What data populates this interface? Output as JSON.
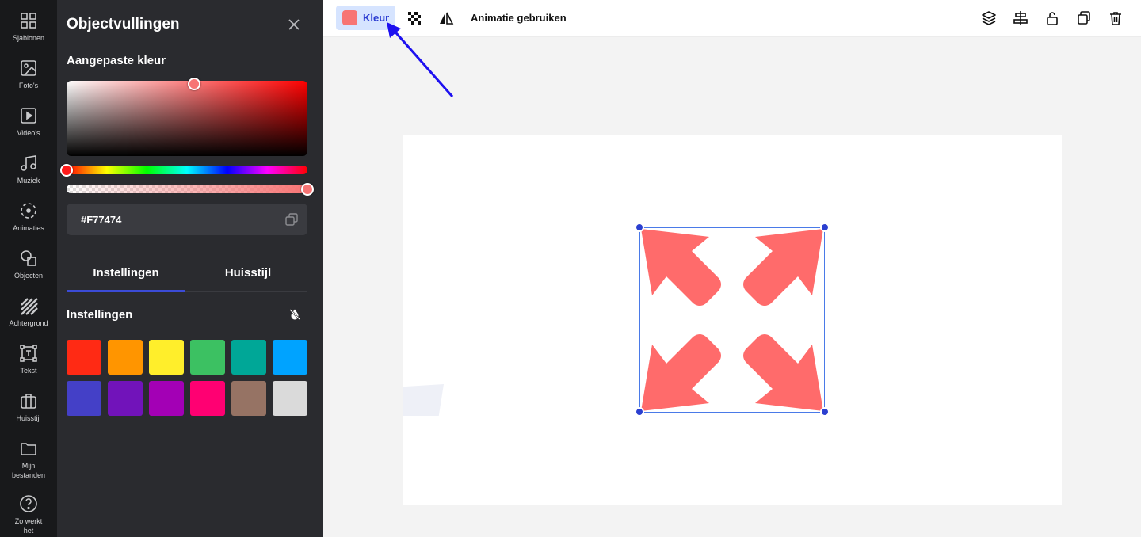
{
  "rail": [
    {
      "label": "Sjablonen",
      "icon": "templates-icon"
    },
    {
      "label": "Foto's",
      "icon": "photo-icon"
    },
    {
      "label": "Video's",
      "icon": "video-icon"
    },
    {
      "label": "Muziek",
      "icon": "music-icon"
    },
    {
      "label": "Animaties",
      "icon": "animation-icon"
    },
    {
      "label": "Objecten",
      "icon": "objects-icon"
    },
    {
      "label": "Achtergrond",
      "icon": "background-icon"
    },
    {
      "label": "Tekst",
      "icon": "text-icon"
    },
    {
      "label": "Huisstijl",
      "icon": "brand-icon"
    },
    {
      "label": "Mijn\nbestanden",
      "icon": "folder-icon"
    },
    {
      "label": "Zo werkt\nhet",
      "icon": "help-icon"
    }
  ],
  "panel": {
    "title": "Objectvullingen",
    "custom_color_title": "Aangepaste kleur",
    "hex_value": "#F77474",
    "tabs": [
      "Instellingen",
      "Huisstijl"
    ],
    "settings_title": "Instellingen",
    "current_color": "#F77474",
    "swatches": [
      "#FF2A14",
      "#FF9500",
      "#FFEE2B",
      "#3CC162",
      "#00A797",
      "#00A3FF",
      "#4440C7",
      "#7113BA",
      "#A300B5",
      "#FF0072",
      "#967364",
      "#DADADA"
    ]
  },
  "toolbar": {
    "color_label": "Kleur",
    "animation_label": "Animatie gebruiken"
  },
  "canvas": {
    "fill_color": "#FF6B6B",
    "selection_color": "#4A7AE8"
  }
}
